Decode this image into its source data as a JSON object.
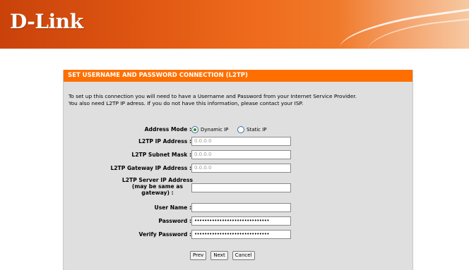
{
  "brand": {
    "logo": "D-Link"
  },
  "section": {
    "title": "SET USERNAME AND PASSWORD CONNECTION (L2TP)",
    "intro_line1": "To set up this connection you will need to have a Username and Password from your Internet Service Provider.",
    "intro_line2": "You also need L2TP IP adress. If you do not have this information, please contact your ISP."
  },
  "form": {
    "address_mode": {
      "label": "Address Mode :",
      "options": [
        {
          "label": "Dynamic IP",
          "selected": true
        },
        {
          "label": "Static IP",
          "selected": false
        }
      ]
    },
    "l2tp_ip": {
      "label": "L2TP IP Address :",
      "placeholder": "0.0.0.0"
    },
    "l2tp_subnet": {
      "label": "L2TP Subnet Mask :",
      "placeholder": "0.0.0.0"
    },
    "l2tp_gateway": {
      "label": "L2TP Gateway IP Address :",
      "placeholder": "0.0.0.0"
    },
    "l2tp_server": {
      "label_line1": "L2TP Server IP Address",
      "label_line2": "(may be same as",
      "label_line3": "gateway) :",
      "value": ""
    },
    "username": {
      "label": "User Name :",
      "value": ""
    },
    "password": {
      "label": "Password :",
      "value": "••••••••••••••••••••••••••••••"
    },
    "verify_password": {
      "label": "Verify Password :",
      "value": "••••••••••••••••••••••••••••••"
    }
  },
  "buttons": {
    "prev": "Prev",
    "next": "Next",
    "cancel": "Cancel"
  },
  "colors": {
    "accent": "#ff6f00",
    "panel_bg": "#dfdfdf"
  }
}
